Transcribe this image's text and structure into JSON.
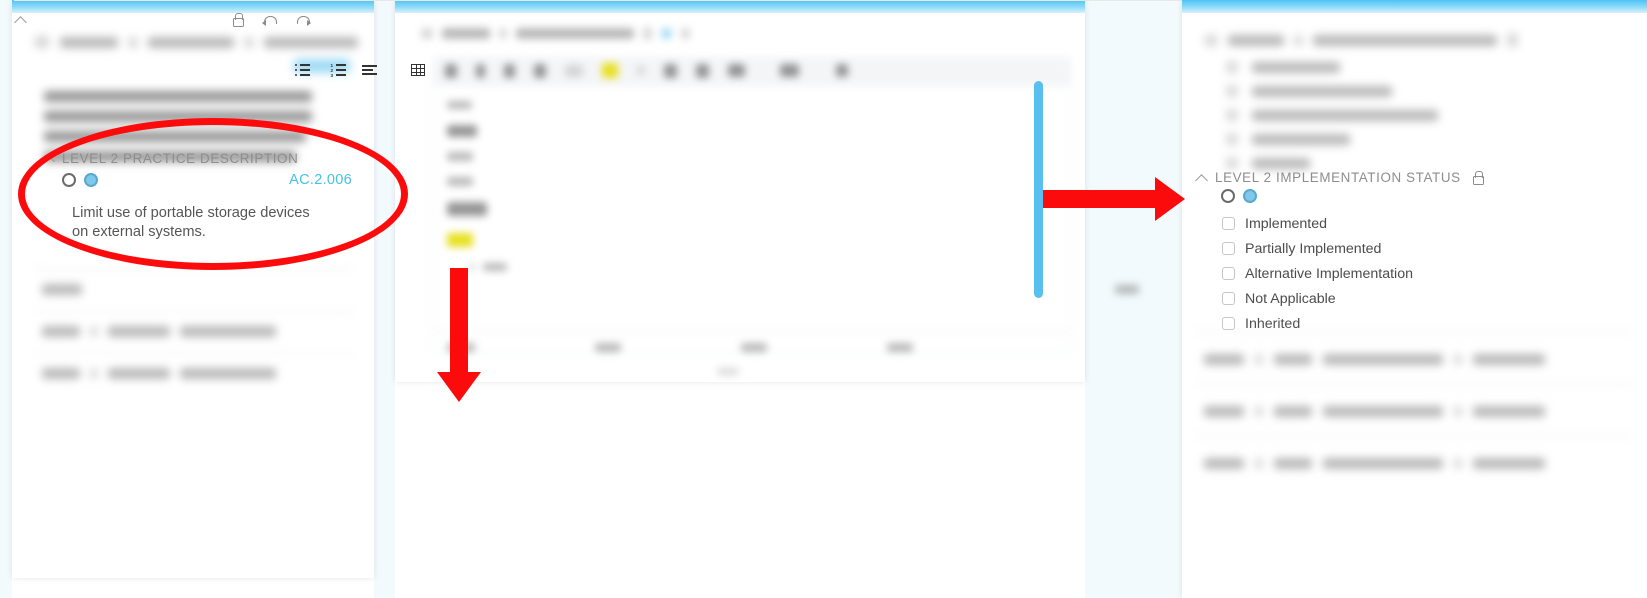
{
  "app": {
    "accent_blue": "#45c0e8",
    "topbar_blue": "#4fc3f7",
    "annotation_red": "#fb0b0b",
    "highlight_yellow": "#ffff00"
  },
  "left_panel": {
    "section": {
      "caret": "chevron-up-icon",
      "title": "LEVEL 2 PRACTICE DESCRIPTION",
      "toggle_unselected": "radio-unselected",
      "toggle_selected": "radio-selected",
      "code": "AC.2.006",
      "description": "Limit use of portable storage devices on external systems."
    },
    "obscured_note": "redacted"
  },
  "center_top_panel": {
    "obscured_note": "redacted",
    "toolbar_icon_count": 12,
    "has_vertical_scrollbar": true
  },
  "center_bottom_panel": {
    "caret": "chevron-up-icon",
    "title": "LEVEL 2 IMPLEMENTATION",
    "lock": "lock-icon",
    "undo": "undo-icon",
    "redo": "redo-icon",
    "toggle_unselected": "radio-unselected",
    "toggle_selected": "radio-selected",
    "toolbar": {
      "bold": "B",
      "italic": "I",
      "underline": "U",
      "strikethrough": "strikethrough-icon",
      "font_size": "14",
      "font_color": "A",
      "font_color_caret": "chevron-down-icon",
      "bullet_list": "bullet-list-icon",
      "numbered_list": "numbered-list-icon",
      "align": "align-icon",
      "table": "table-icon",
      "expand": "expand-icon"
    },
    "editor_value": "",
    "editor_placeholder": ""
  },
  "right_panel": {
    "section": {
      "caret": "chevron-up-icon",
      "title": "LEVEL 2 IMPLEMENTATION STATUS",
      "lock": "lock-icon",
      "toggle_unselected": "radio-unselected",
      "toggle_selected": "radio-selected"
    },
    "checkboxes": [
      {
        "label": "Implemented",
        "checked": false
      },
      {
        "label": "Partially Implemented",
        "checked": false
      },
      {
        "label": "Alternative Implementation",
        "checked": false
      },
      {
        "label": "Not Applicable",
        "checked": false
      },
      {
        "label": "Inherited",
        "checked": false
      }
    ],
    "obscured_note": "redacted"
  },
  "annotations": [
    {
      "kind": "ellipse",
      "target": "level-2-practice-description-section"
    },
    {
      "kind": "arrow",
      "direction": "down",
      "from": "practice-description",
      "to": "level-2-implementation-editor"
    },
    {
      "kind": "arrow",
      "direction": "right",
      "from": "practice-description",
      "to": "level-2-implementation-status"
    }
  ]
}
